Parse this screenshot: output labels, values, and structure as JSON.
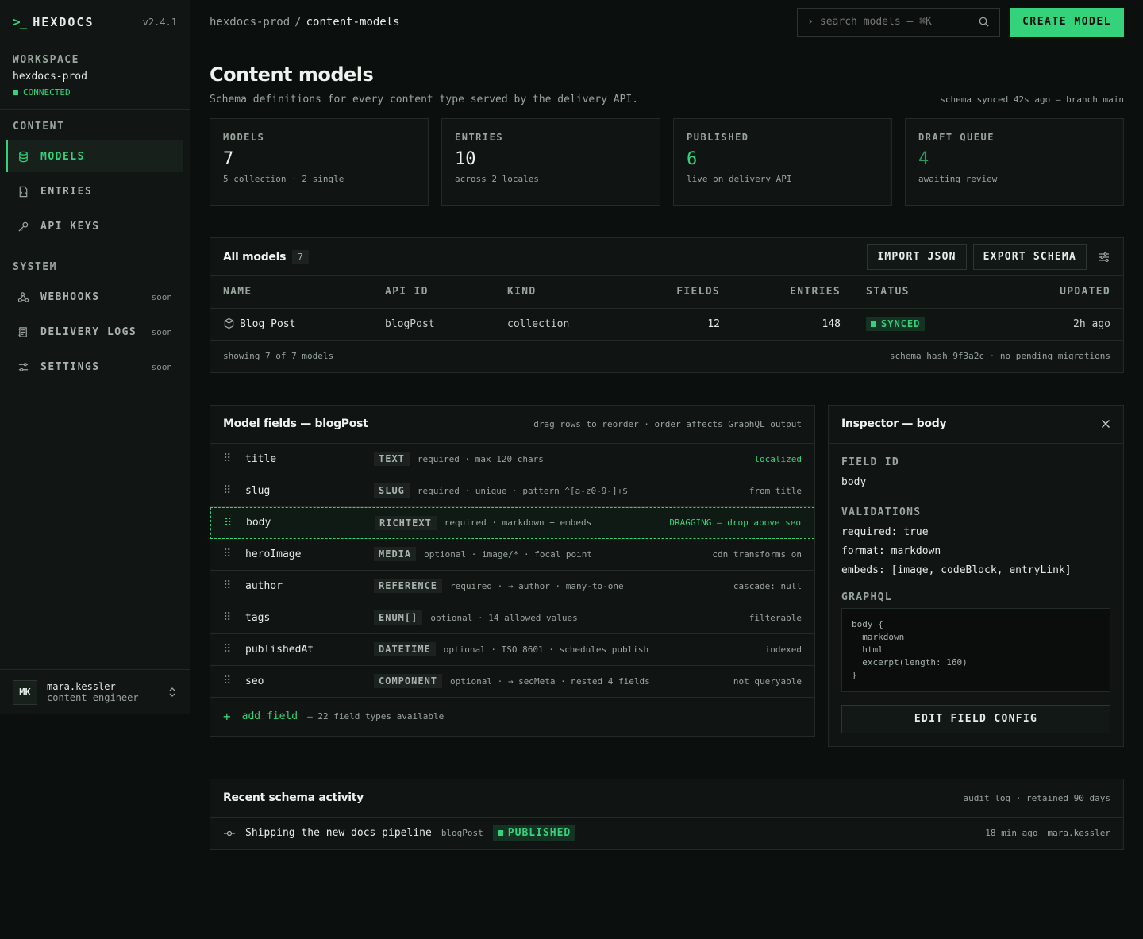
{
  "brand": {
    "mark": ">_",
    "name": "HEXDOCS",
    "version": "v2.4.1"
  },
  "workspace": {
    "title": "WORKSPACE",
    "name": "hexdocs-prod",
    "status": "CONNECTED"
  },
  "nav": {
    "content_title": "CONTENT",
    "system_title": "SYSTEM",
    "content_items": [
      {
        "label": "MODELS",
        "icon": "database-icon",
        "active": true
      },
      {
        "label": "ENTRIES",
        "icon": "file-icon"
      },
      {
        "label": "API KEYS",
        "icon": "key-icon"
      }
    ],
    "system_items": [
      {
        "label": "WEBHOOKS",
        "icon": "webhook-icon",
        "badge": "soon"
      },
      {
        "label": "DELIVERY LOGS",
        "icon": "logs-icon",
        "badge": "soon"
      },
      {
        "label": "SETTINGS",
        "icon": "sliders-icon",
        "badge": "soon"
      }
    ]
  },
  "user": {
    "initials": "MK",
    "name": "mara.kessler",
    "role": "content engineer"
  },
  "topbar": {
    "breadcrumb_root": "hexdocs-prod",
    "breadcrumb_sep": "/",
    "breadcrumb_current": "content-models",
    "search_placeholder": "search models — ⌘K",
    "create_label": "CREATE MODEL"
  },
  "page": {
    "title": "Content models",
    "subtitle": "Schema definitions for every content type served by the delivery API.",
    "sync_note": "schema synced 42s ago — branch main"
  },
  "stats": [
    {
      "label": "MODELS",
      "value": "7",
      "note": "5 collection · 2 single"
    },
    {
      "label": "ENTRIES",
      "value": "10",
      "note": "across 2 locales"
    },
    {
      "label": "PUBLISHED",
      "value": "6",
      "note": "live on delivery API"
    },
    {
      "label": "DRAFT QUEUE",
      "value": "4",
      "note": "awaiting review"
    }
  ],
  "models_table": {
    "title": "All models",
    "count": "7",
    "import_label": "IMPORT JSON",
    "export_label": "EXPORT SCHEMA",
    "columns": [
      "NAME",
      "API ID",
      "KIND",
      "FIELDS",
      "ENTRIES",
      "STATUS",
      "UPDATED"
    ],
    "rows": [
      {
        "name": "Blog Post",
        "api_id": "blogPost",
        "kind": "collection",
        "fields": "12",
        "entries": "148",
        "status": "SYNCED",
        "updated": "2h ago"
      }
    ],
    "footer_left": "showing 7 of 7 models",
    "footer_right": "schema hash 9f3a2c · no pending migrations"
  },
  "fields_panel": {
    "title": "Model fields — blogPost",
    "hint": "drag rows to reorder · order affects GraphQL output",
    "fields": [
      {
        "name": "title",
        "type": "TEXT",
        "desc": "required · max 120 chars",
        "right": "localized"
      },
      {
        "name": "slug",
        "type": "SLUG",
        "desc": "required · unique · pattern ^[a-z0-9-]+$",
        "right": "from title"
      },
      {
        "name": "body",
        "type": "RICHTEXT",
        "desc": "required · markdown + embeds",
        "right": "DRAGGING — drop above seo"
      },
      {
        "name": "heroImage",
        "type": "MEDIA",
        "desc": "optional · image/* · focal point",
        "right": "cdn transforms on"
      },
      {
        "name": "author",
        "type": "REFERENCE",
        "desc": "required · → author · many-to-one",
        "right": "cascade: null"
      },
      {
        "name": "tags",
        "type": "ENUM[]",
        "desc": "optional · 14 allowed values",
        "right": "filterable"
      },
      {
        "name": "publishedAt",
        "type": "DATETIME",
        "desc": "optional · ISO 8601 · schedules publish",
        "right": "indexed"
      },
      {
        "name": "seo",
        "type": "COMPONENT",
        "desc": "optional · → seoMeta · nested 4 fields",
        "right": "not queryable"
      }
    ],
    "add_label": "add field",
    "add_note": "— 22 field types available"
  },
  "inspector": {
    "title": "Inspector — body",
    "field_id_label": "FIELD ID",
    "field_id": "body",
    "validations_label": "VALIDATIONS",
    "validations": [
      "required: true",
      "format: markdown",
      "embeds: [image, codeBlock, entryLink]"
    ],
    "graphql_label": "GRAPHQL",
    "graphql_code": "body {\n  markdown\n  html\n  excerpt(length: 160)\n}",
    "edit_label": "EDIT FIELD CONFIG"
  },
  "activity": {
    "title": "Recent schema activity",
    "note": "audit log · retained 90 days",
    "items": [
      {
        "message": "Shipping the new docs pipeline",
        "model": "blogPost",
        "status": "PUBLISHED",
        "time": "18 min ago",
        "user": "mara.kessler"
      }
    ]
  },
  "colors": {
    "accent": "#34d27b",
    "background": "#0b0f0d",
    "panel": "#101513",
    "border": "#232b27"
  }
}
